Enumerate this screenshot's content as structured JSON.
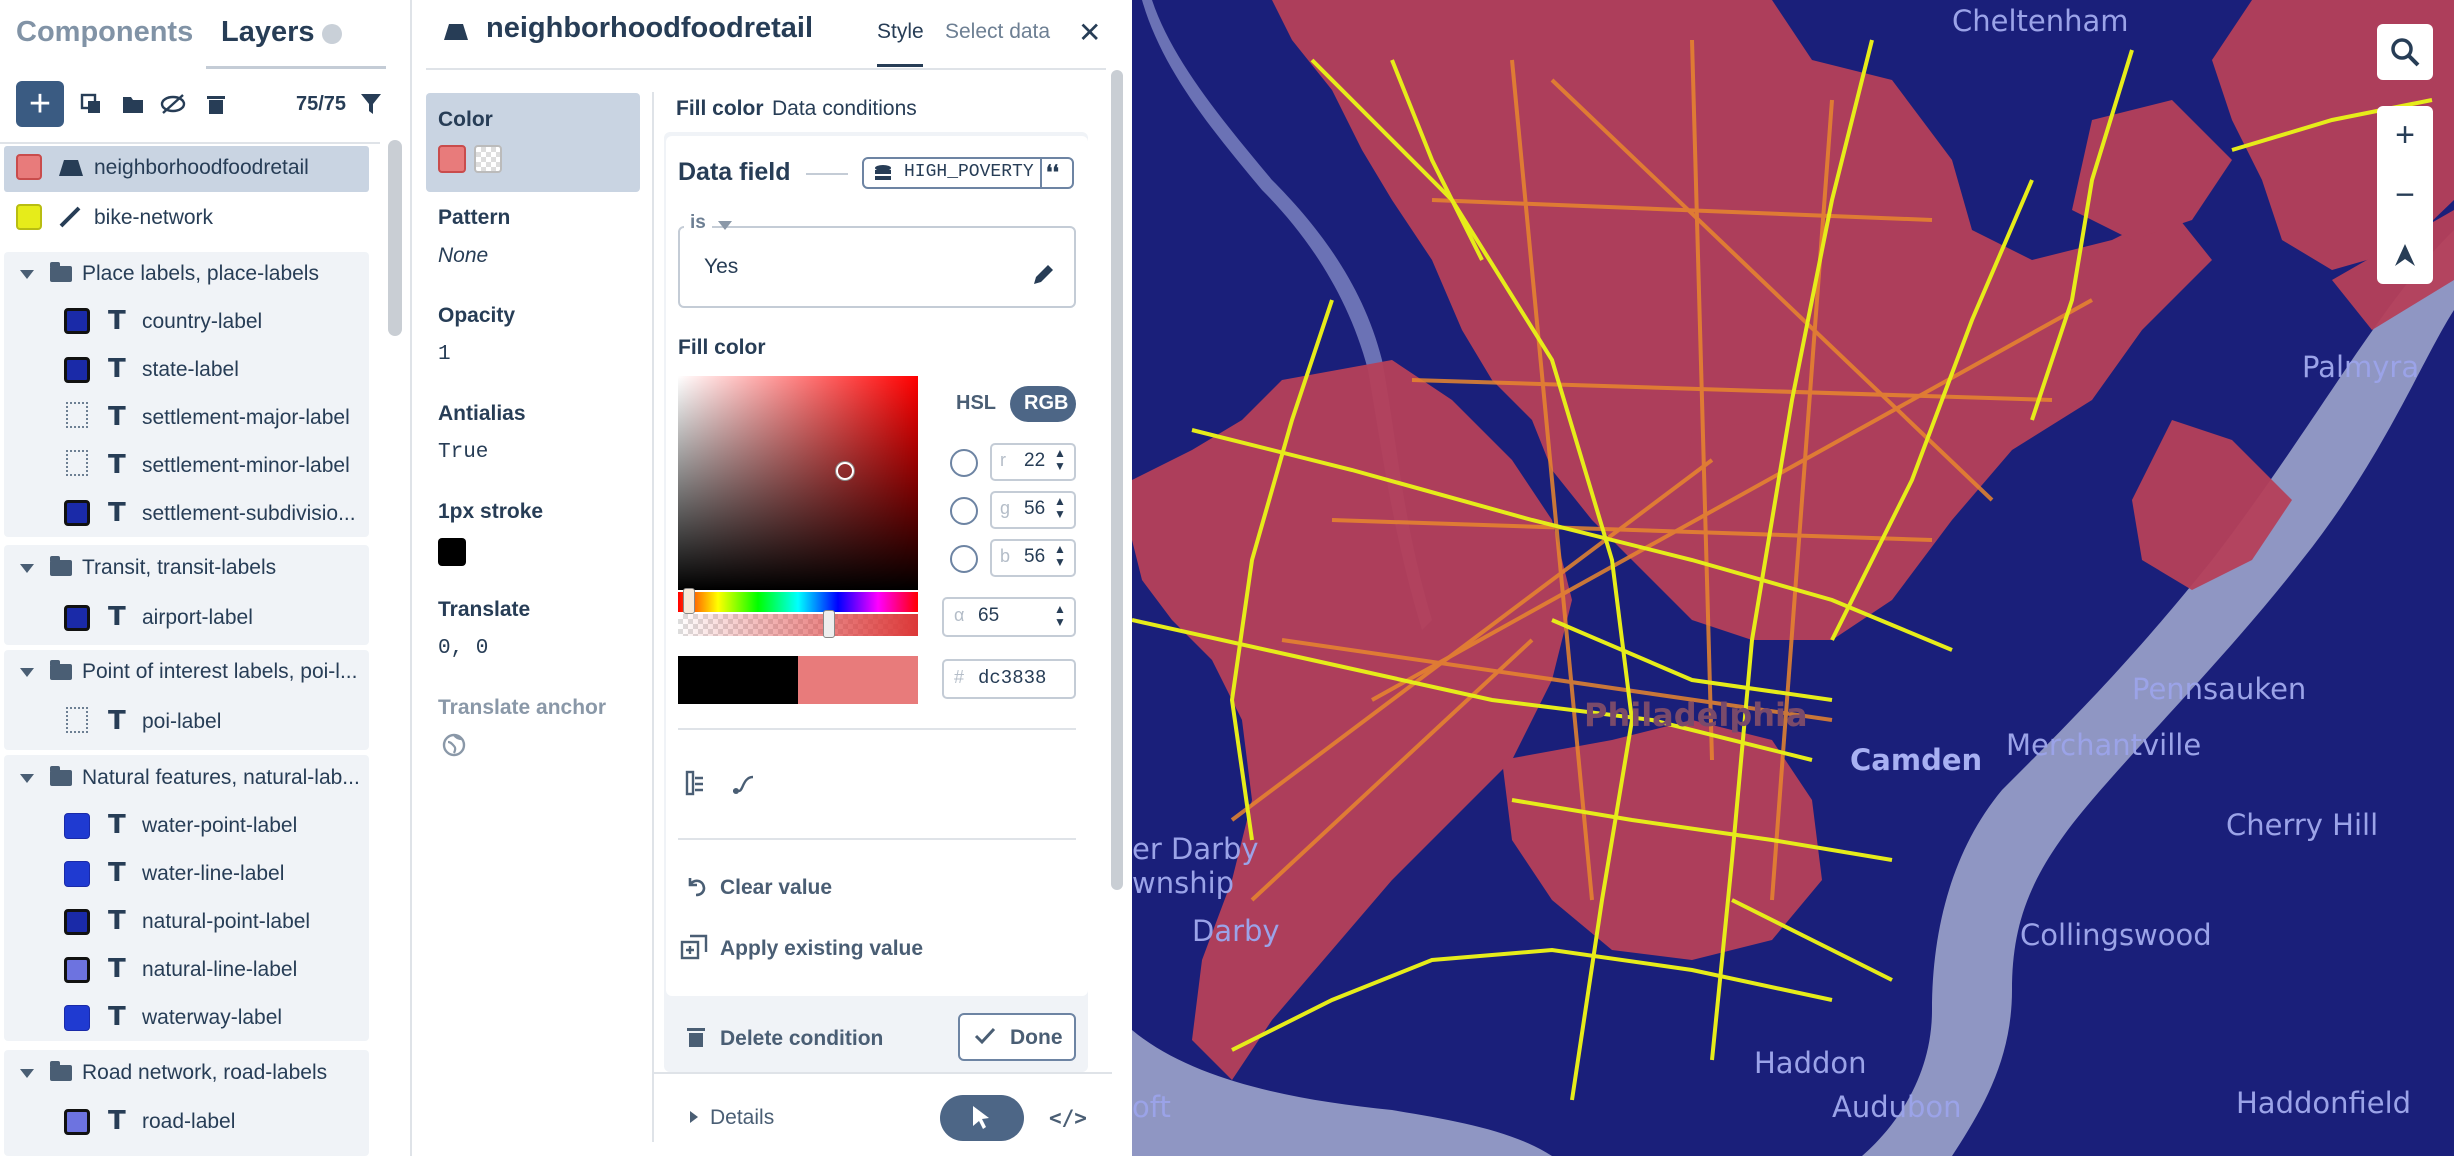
{
  "left_panel": {
    "tabs": [
      "Components",
      "Layers"
    ],
    "layer_count": "75/75",
    "layers": [
      {
        "name": "neighborhoodfoodretail",
        "color": "#e87b7b"
      },
      {
        "name": "bike-network",
        "color": "#e6ec1a"
      }
    ],
    "groups": [
      {
        "name": "Place labels, place-labels",
        "items": [
          "country-label",
          "state-label",
          "settlement-major-label",
          "settlement-minor-label",
          "settlement-subdivisio..."
        ]
      },
      {
        "name": "Transit, transit-labels",
        "items": [
          "airport-label"
        ]
      },
      {
        "name": "Point of interest labels, poi-l...",
        "items": [
          "poi-label"
        ]
      },
      {
        "name": "Natural features, natural-lab...",
        "items": [
          "water-point-label",
          "water-line-label",
          "natural-point-label",
          "natural-line-label",
          "waterway-label"
        ]
      },
      {
        "name": "Road network, road-labels",
        "items": [
          "road-label"
        ]
      }
    ]
  },
  "editor": {
    "title": "neighborhoodfoodretail",
    "tabs": {
      "style": "Style",
      "select_data": "Select data"
    },
    "properties": [
      {
        "label": "Color",
        "value": ""
      },
      {
        "label": "Pattern",
        "value": "None"
      },
      {
        "label": "Opacity",
        "value": "1"
      },
      {
        "label": "Antialias",
        "value": "True"
      },
      {
        "label": "1px stroke",
        "value": ""
      },
      {
        "label": "Translate",
        "value": "0, 0"
      },
      {
        "label": "Translate anchor",
        "value": ""
      }
    ],
    "subtabs": {
      "fill": "Fill color",
      "conditions": "Data conditions"
    },
    "data_field_label": "Data field",
    "data_field_value": "HIGH_POVERTY",
    "is_label": "is",
    "is_value": "Yes",
    "fill_color_label": "Fill color",
    "color_modes": {
      "hsl": "HSL",
      "rgb": "RGB"
    },
    "rgb": {
      "r": "22",
      "g": "56",
      "b": "56"
    },
    "channel_letters": {
      "r": "r",
      "g": "g",
      "b": "b",
      "a": "α",
      "hash": "#"
    },
    "alpha": "65",
    "hex": "dc3838",
    "clear_value": "Clear value",
    "apply_existing": "Apply existing value",
    "delete_condition": "Delete condition",
    "done": "Done",
    "details": "Details",
    "code_icon_text": "</>"
  },
  "map": {
    "labels": [
      "Cheltenham",
      "Palmyra",
      "Pennsauken",
      "Merchantville",
      "Camden",
      "Cherry Hill",
      "Philadelphia",
      "er Darby",
      "wnship",
      "Darby",
      "Collingswood",
      "Haddon",
      "Haddonfield",
      "Audubon",
      "oft"
    ],
    "colors": {
      "water": "#1a1f7a",
      "poverty_fill": "#b5405a",
      "bike": "#e6ec1a",
      "river": "#8f96c3"
    }
  }
}
